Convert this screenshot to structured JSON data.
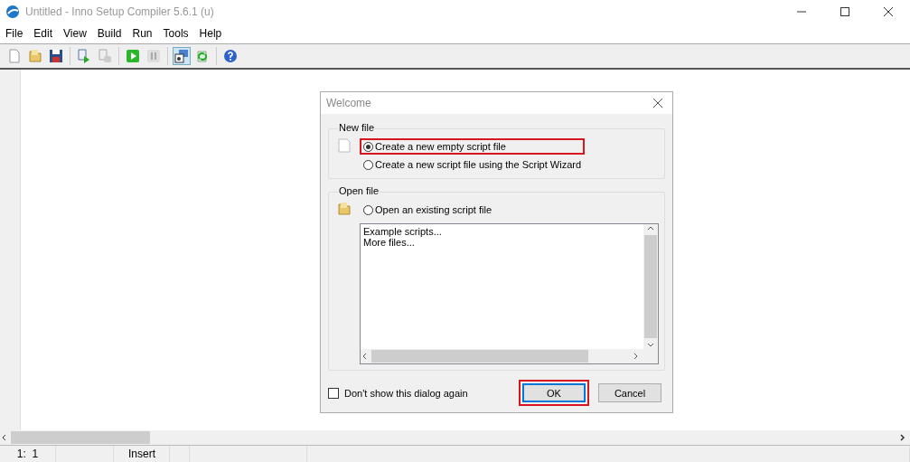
{
  "window": {
    "title": "Untitled - Inno Setup Compiler 5.6.1 (u)"
  },
  "menu": [
    "File",
    "Edit",
    "View",
    "Build",
    "Run",
    "Tools",
    "Help"
  ],
  "toolbar": [
    [
      {
        "kind": "new",
        "selected": false
      },
      {
        "kind": "open",
        "selected": false
      },
      {
        "kind": "save",
        "selected": false
      }
    ],
    [
      {
        "kind": "compile",
        "selected": false
      },
      {
        "kind": "stop",
        "selected": false
      }
    ],
    [
      {
        "kind": "run",
        "selected": false
      },
      {
        "kind": "pause",
        "selected": false
      }
    ],
    [
      {
        "kind": "target",
        "selected": true
      },
      {
        "kind": "refresh",
        "selected": false
      }
    ],
    [
      {
        "kind": "help",
        "selected": false
      }
    ]
  ],
  "dialog": {
    "title": "Welcome",
    "new_file": {
      "label": "New file",
      "options": [
        {
          "label": "Create a new empty script file",
          "selected": true,
          "highlighted": true
        },
        {
          "label": "Create a new script file using the Script Wizard",
          "selected": false,
          "highlighted": false
        }
      ]
    },
    "open_file": {
      "label": "Open file",
      "options": [
        {
          "label": "Open an existing script file",
          "selected": false,
          "highlighted": false
        }
      ],
      "list": [
        "Example scripts...",
        "More files..."
      ]
    },
    "dont_show": {
      "label": "Don't show this dialog again",
      "checked": false
    },
    "buttons": [
      {
        "label": "OK",
        "default": true,
        "highlighted": true
      },
      {
        "label": "Cancel",
        "default": false,
        "highlighted": false
      }
    ]
  },
  "status_bar": {
    "position": "1:  1",
    "mode": "Insert"
  }
}
